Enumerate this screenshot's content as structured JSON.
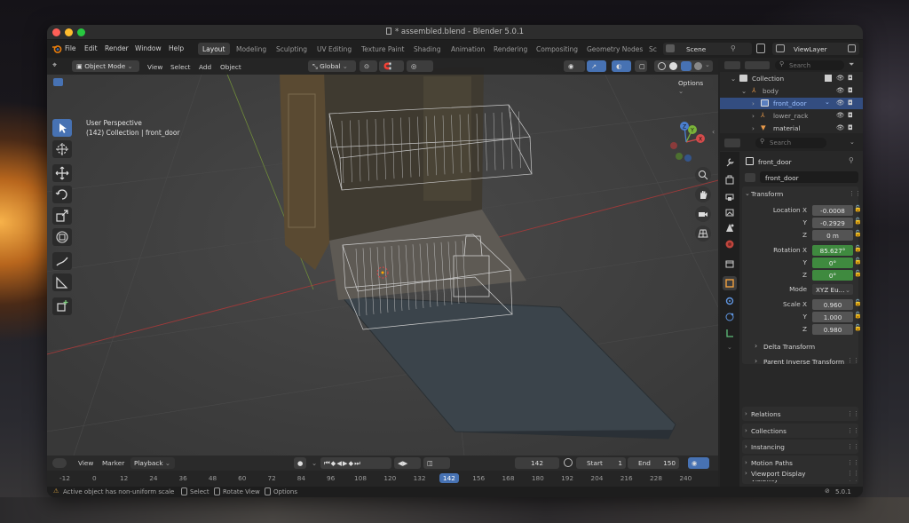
{
  "window": {
    "title": "* assembled.blend - Blender 5.0.1"
  },
  "menubar": {
    "menus": [
      "File",
      "Edit",
      "Render",
      "Window",
      "Help"
    ],
    "tabs": [
      "Layout",
      "Modeling",
      "Sculpting",
      "UV Editing",
      "Texture Paint",
      "Shading",
      "Animation",
      "Rendering",
      "Compositing",
      "Geometry Nodes",
      "Sc"
    ],
    "active_tab": "Layout",
    "scene": "Scene",
    "view_layer": "ViewLayer"
  },
  "viewport": {
    "mode": "Object Mode",
    "menus": [
      "View",
      "Select",
      "Add",
      "Object"
    ],
    "orientation": "Global",
    "options_label": "Options",
    "overlay_line1": "User Perspective",
    "overlay_line2": "(142) Collection | front_door",
    "gizmo": {
      "x": "X",
      "y": "Y",
      "z": "Z"
    }
  },
  "outliner": {
    "search_placeholder": "Search",
    "items": [
      {
        "label": "Collection"
      },
      {
        "label": "body"
      },
      {
        "label": "front_door",
        "selected": true
      },
      {
        "label": "lower_rack"
      },
      {
        "label": "material"
      }
    ]
  },
  "properties": {
    "search_placeholder": "Search",
    "object_name": "front_door",
    "object_data_name": "front_door",
    "transform_title": "Transform",
    "location": {
      "label": "Location X",
      "x": "-0.0008",
      "y": "-0.2929",
      "z": "0 m"
    },
    "rotation": {
      "label": "Rotation X",
      "x": "85.627°",
      "y": "0°",
      "z": "0°"
    },
    "mode": {
      "label": "Mode",
      "value": "XYZ Eu..."
    },
    "scale": {
      "label": "Scale X",
      "x": "0.960",
      "y": "1.000",
      "z": "0.980"
    },
    "axis_y": "Y",
    "axis_z": "Z",
    "subpanels": [
      "Delta Transform",
      "Parent Inverse Transform"
    ],
    "panels": [
      "Relations",
      "Collections",
      "Instancing",
      "Motion Paths",
      "Visibility",
      "Viewport Display"
    ]
  },
  "timeline": {
    "menus": [
      "View",
      "Marker",
      "Playback"
    ],
    "current_frame": "142",
    "start_label": "Start",
    "start": "1",
    "end_label": "End",
    "end": "150",
    "ticks": [
      "-12",
      "0",
      "12",
      "24",
      "36",
      "48",
      "60",
      "72",
      "84",
      "96",
      "108",
      "120",
      "132",
      "142",
      "156",
      "168",
      "180",
      "192",
      "204",
      "216",
      "228",
      "240"
    ]
  },
  "statusbar": {
    "message": "Active object has non-uniform scale",
    "hint_select": "Select",
    "hint_rotate": "Rotate View",
    "hint_options": "Options",
    "version": "5.0.1"
  },
  "colors": {
    "accent": "#4772b3",
    "selected_row": "#334d80",
    "animated_field": "#3f8a3f",
    "frame_indicator": "#4772b3"
  }
}
